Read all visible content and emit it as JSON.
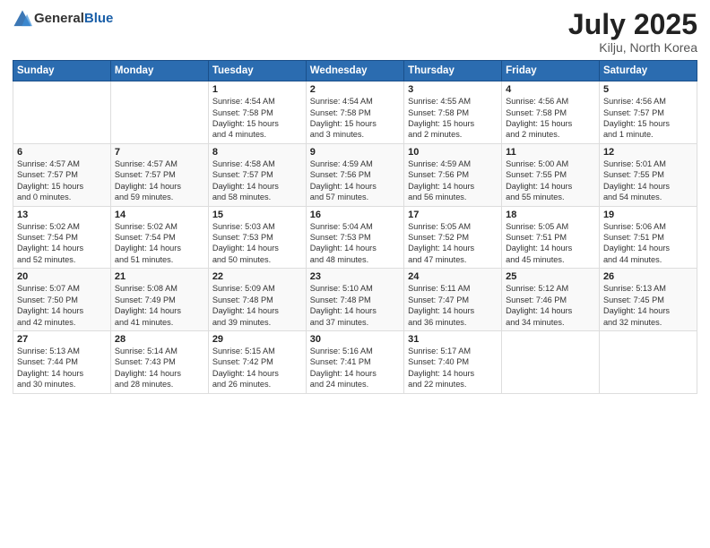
{
  "header": {
    "logo_general": "General",
    "logo_blue": "Blue",
    "title": "July 2025",
    "location": "Kilju, North Korea"
  },
  "weekdays": [
    "Sunday",
    "Monday",
    "Tuesday",
    "Wednesday",
    "Thursday",
    "Friday",
    "Saturday"
  ],
  "weeks": [
    [
      {
        "day": "",
        "info": ""
      },
      {
        "day": "",
        "info": ""
      },
      {
        "day": "1",
        "info": "Sunrise: 4:54 AM\nSunset: 7:58 PM\nDaylight: 15 hours\nand 4 minutes."
      },
      {
        "day": "2",
        "info": "Sunrise: 4:54 AM\nSunset: 7:58 PM\nDaylight: 15 hours\nand 3 minutes."
      },
      {
        "day": "3",
        "info": "Sunrise: 4:55 AM\nSunset: 7:58 PM\nDaylight: 15 hours\nand 2 minutes."
      },
      {
        "day": "4",
        "info": "Sunrise: 4:56 AM\nSunset: 7:58 PM\nDaylight: 15 hours\nand 2 minutes."
      },
      {
        "day": "5",
        "info": "Sunrise: 4:56 AM\nSunset: 7:57 PM\nDaylight: 15 hours\nand 1 minute."
      }
    ],
    [
      {
        "day": "6",
        "info": "Sunrise: 4:57 AM\nSunset: 7:57 PM\nDaylight: 15 hours\nand 0 minutes."
      },
      {
        "day": "7",
        "info": "Sunrise: 4:57 AM\nSunset: 7:57 PM\nDaylight: 14 hours\nand 59 minutes."
      },
      {
        "day": "8",
        "info": "Sunrise: 4:58 AM\nSunset: 7:57 PM\nDaylight: 14 hours\nand 58 minutes."
      },
      {
        "day": "9",
        "info": "Sunrise: 4:59 AM\nSunset: 7:56 PM\nDaylight: 14 hours\nand 57 minutes."
      },
      {
        "day": "10",
        "info": "Sunrise: 4:59 AM\nSunset: 7:56 PM\nDaylight: 14 hours\nand 56 minutes."
      },
      {
        "day": "11",
        "info": "Sunrise: 5:00 AM\nSunset: 7:55 PM\nDaylight: 14 hours\nand 55 minutes."
      },
      {
        "day": "12",
        "info": "Sunrise: 5:01 AM\nSunset: 7:55 PM\nDaylight: 14 hours\nand 54 minutes."
      }
    ],
    [
      {
        "day": "13",
        "info": "Sunrise: 5:02 AM\nSunset: 7:54 PM\nDaylight: 14 hours\nand 52 minutes."
      },
      {
        "day": "14",
        "info": "Sunrise: 5:02 AM\nSunset: 7:54 PM\nDaylight: 14 hours\nand 51 minutes."
      },
      {
        "day": "15",
        "info": "Sunrise: 5:03 AM\nSunset: 7:53 PM\nDaylight: 14 hours\nand 50 minutes."
      },
      {
        "day": "16",
        "info": "Sunrise: 5:04 AM\nSunset: 7:53 PM\nDaylight: 14 hours\nand 48 minutes."
      },
      {
        "day": "17",
        "info": "Sunrise: 5:05 AM\nSunset: 7:52 PM\nDaylight: 14 hours\nand 47 minutes."
      },
      {
        "day": "18",
        "info": "Sunrise: 5:05 AM\nSunset: 7:51 PM\nDaylight: 14 hours\nand 45 minutes."
      },
      {
        "day": "19",
        "info": "Sunrise: 5:06 AM\nSunset: 7:51 PM\nDaylight: 14 hours\nand 44 minutes."
      }
    ],
    [
      {
        "day": "20",
        "info": "Sunrise: 5:07 AM\nSunset: 7:50 PM\nDaylight: 14 hours\nand 42 minutes."
      },
      {
        "day": "21",
        "info": "Sunrise: 5:08 AM\nSunset: 7:49 PM\nDaylight: 14 hours\nand 41 minutes."
      },
      {
        "day": "22",
        "info": "Sunrise: 5:09 AM\nSunset: 7:48 PM\nDaylight: 14 hours\nand 39 minutes."
      },
      {
        "day": "23",
        "info": "Sunrise: 5:10 AM\nSunset: 7:48 PM\nDaylight: 14 hours\nand 37 minutes."
      },
      {
        "day": "24",
        "info": "Sunrise: 5:11 AM\nSunset: 7:47 PM\nDaylight: 14 hours\nand 36 minutes."
      },
      {
        "day": "25",
        "info": "Sunrise: 5:12 AM\nSunset: 7:46 PM\nDaylight: 14 hours\nand 34 minutes."
      },
      {
        "day": "26",
        "info": "Sunrise: 5:13 AM\nSunset: 7:45 PM\nDaylight: 14 hours\nand 32 minutes."
      }
    ],
    [
      {
        "day": "27",
        "info": "Sunrise: 5:13 AM\nSunset: 7:44 PM\nDaylight: 14 hours\nand 30 minutes."
      },
      {
        "day": "28",
        "info": "Sunrise: 5:14 AM\nSunset: 7:43 PM\nDaylight: 14 hours\nand 28 minutes."
      },
      {
        "day": "29",
        "info": "Sunrise: 5:15 AM\nSunset: 7:42 PM\nDaylight: 14 hours\nand 26 minutes."
      },
      {
        "day": "30",
        "info": "Sunrise: 5:16 AM\nSunset: 7:41 PM\nDaylight: 14 hours\nand 24 minutes."
      },
      {
        "day": "31",
        "info": "Sunrise: 5:17 AM\nSunset: 7:40 PM\nDaylight: 14 hours\nand 22 minutes."
      },
      {
        "day": "",
        "info": ""
      },
      {
        "day": "",
        "info": ""
      }
    ]
  ]
}
